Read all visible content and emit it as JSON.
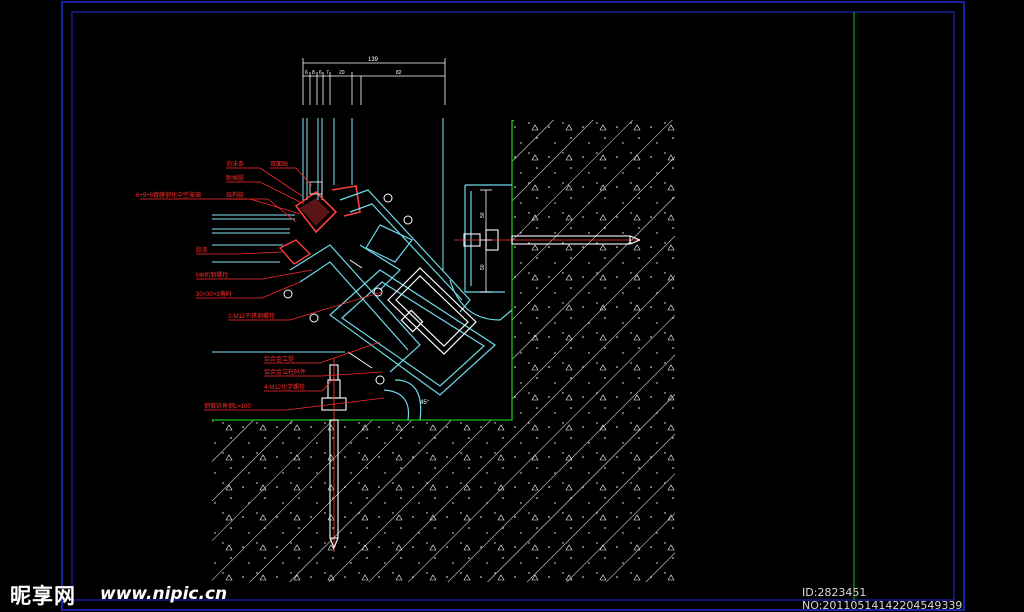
{
  "drawing": {
    "colors": {
      "background": "#000000",
      "frame": "#1e2dd8",
      "title_line": "#19c419",
      "glass": "#7fe8f5",
      "profile": "#6fd9e8",
      "leader": "#ff2a2a",
      "dimension": "#ffffff",
      "hatch": "#ffffff",
      "sealant": "#ff3b3b",
      "bolt": "#ffffff"
    },
    "dimensions": {
      "overall": "139",
      "segments": [
        "6",
        "8",
        "6",
        "7",
        "20",
        "82"
      ],
      "bracket_vertical": [
        "50",
        "50"
      ]
    },
    "labels": [
      "泡沫条",
      "双面贴",
      "耐候胶",
      "6+9+6镀膜钢化中空玻璃",
      "结构胶",
      "胶条",
      "M6机制螺栓",
      "30×30×3角码",
      "2-M12不锈钢螺栓",
      "铝合金立挺",
      "铝合金立柱码件",
      "4-M12化学螺栓",
      "钢镀锌角钢L=100"
    ],
    "angle_note": "45°"
  },
  "watermark": {
    "logo": "昵享网",
    "url": "www.nipic.cn",
    "id": "ID:2823451 NO:20110514142204549339"
  }
}
